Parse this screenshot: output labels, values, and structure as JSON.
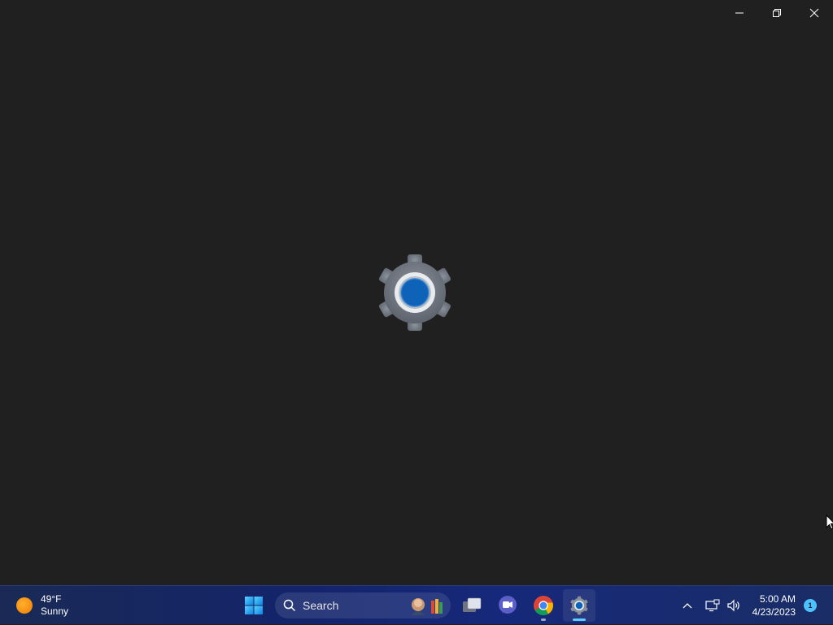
{
  "window": {
    "app": "Settings",
    "icon": "gear-icon",
    "caption_buttons": [
      "minimize",
      "restore",
      "close"
    ]
  },
  "taskbar": {
    "weather": {
      "temperature": "49°F",
      "condition": "Sunny",
      "icon": "sun-icon"
    },
    "search": {
      "placeholder": "Search"
    },
    "pinned_apps": [
      {
        "name": "start-button",
        "active": false,
        "running": false
      },
      {
        "name": "task-view",
        "active": false,
        "running": false
      },
      {
        "name": "teams-chat",
        "active": false,
        "running": false
      },
      {
        "name": "chrome",
        "active": false,
        "running": true
      },
      {
        "name": "settings",
        "active": true,
        "running": true
      }
    ],
    "tray": {
      "clock_time": "5:00 AM",
      "clock_date": "4/23/2023",
      "notification_count": "1"
    }
  },
  "colors": {
    "window_bg": "#202020",
    "accent": "#60cdff",
    "gear_center": "#0e63b8",
    "taskbar_bg": "#16287a"
  }
}
